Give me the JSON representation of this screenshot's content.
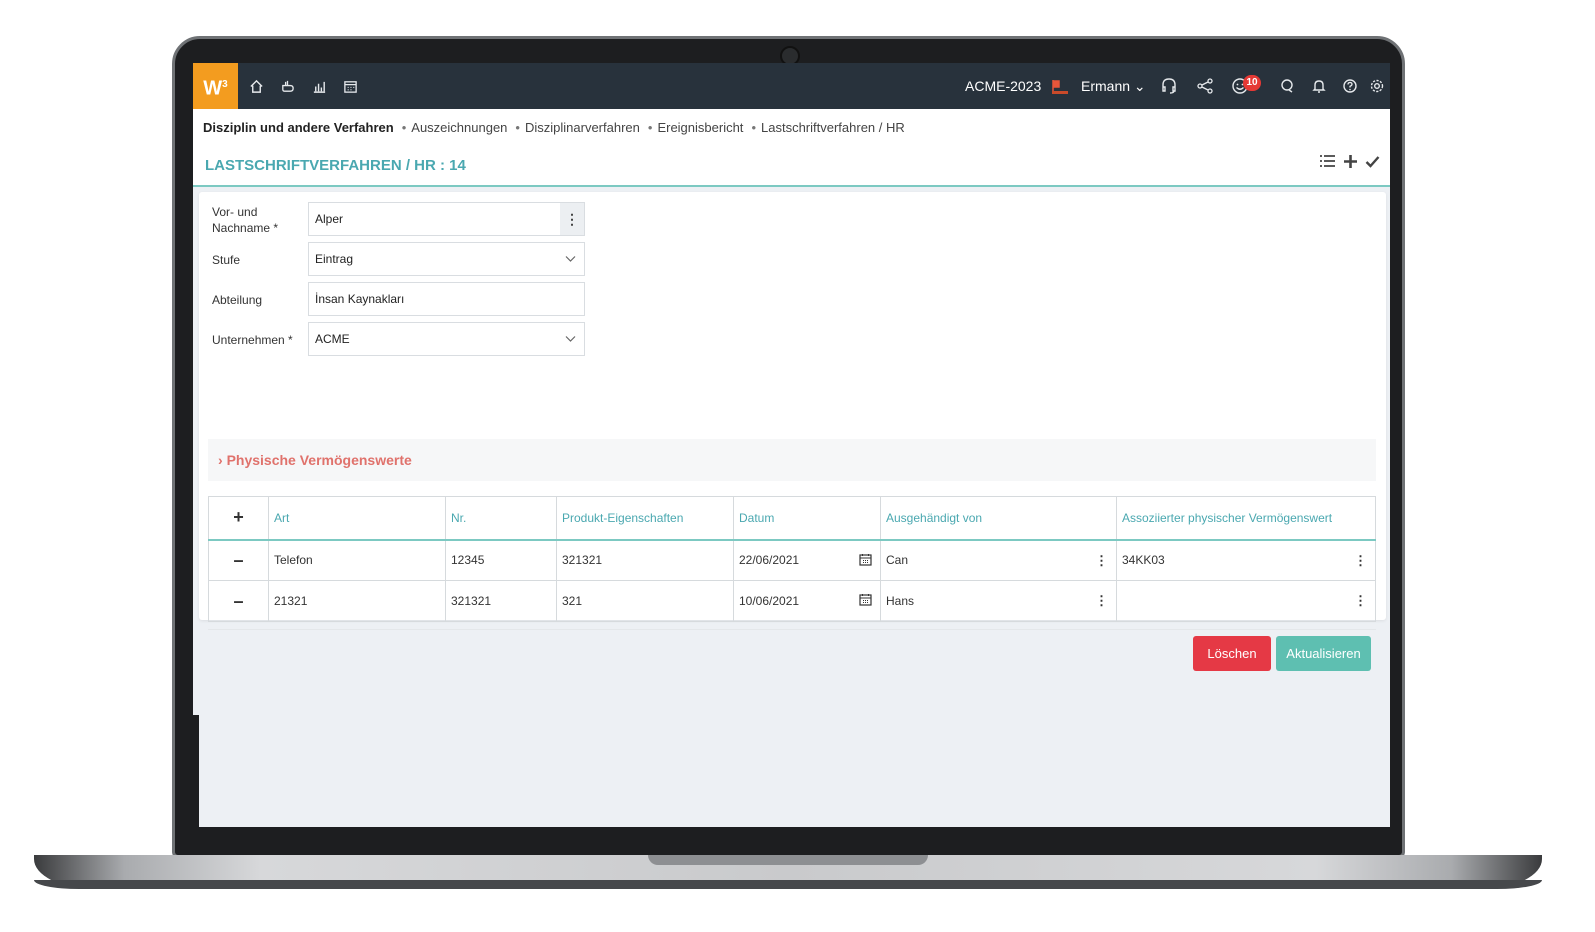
{
  "topbar": {
    "logo": "W",
    "logo_sup": "3",
    "company": "ACME-2023",
    "user": "Ermann",
    "notification_count": "10",
    "icons": [
      "home-icon",
      "hand-icon",
      "chart-icon",
      "calendar-icon",
      "headset-icon",
      "share-icon",
      "smiley-icon",
      "chat-icon",
      "bell-icon",
      "help-icon",
      "settings-icon"
    ]
  },
  "breadcrumb": {
    "first": "Disziplin und andere Verfahren",
    "items": [
      "Auszeichnungen",
      "Disziplinarverfahren",
      "Ereignisbericht",
      "Lastschriftverfahren / HR"
    ]
  },
  "page": {
    "title": "LASTSCHRIFTVERFAHREN / HR : 14"
  },
  "form": {
    "name_label_1": "Vor- und",
    "name_label_2": "Nachname *",
    "name_value": "Alper",
    "stufe_label": "Stufe",
    "stufe_value": "Eintrag",
    "abteilung_label": "Abteilung",
    "abteilung_value": "İnsan Kaynakları",
    "unternehmen_label": "Unternehmen *",
    "unternehmen_value": "ACME"
  },
  "section": {
    "title": "Physische Vermögenswerte"
  },
  "table": {
    "headers": [
      "Art",
      "Nr.",
      "Produkt-Eigenschaften",
      "Datum",
      "Ausgehändigt von",
      "Assoziierter physischer Vermögenswert"
    ],
    "rows": [
      [
        "Telefon",
        "12345",
        "321321",
        "22/06/2021",
        "Can",
        "34KK03"
      ],
      [
        "21321",
        "321321",
        "321",
        "10/06/2021",
        "Hans",
        ""
      ]
    ]
  },
  "actions": {
    "delete": "Löschen",
    "update": "Aktualisieren"
  },
  "colors": {
    "accent": "#4aa8b0",
    "logo": "#f39c1f",
    "topbar": "#28323c",
    "danger": "#e53945",
    "success": "#5ebfb1",
    "section": "#e0726c"
  }
}
